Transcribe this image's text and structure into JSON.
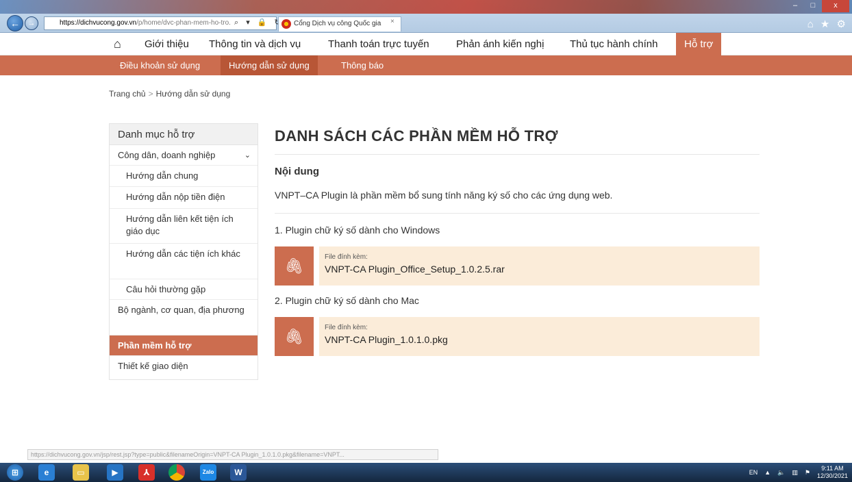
{
  "browser": {
    "url_host": "https://dichvucong.gov.vn",
    "url_path": "/p/home/dvc-phan-mem-ho-tro.",
    "tab_title": "Cổng Dịch vụ công Quốc gia",
    "tab_close": "×",
    "back": "←",
    "forward": "→",
    "address_icons": "⌕ ▾ 🔒 ↻"
  },
  "topnav": {
    "items": [
      "Giới thiệu",
      "Thông tin và dịch vụ",
      "Thanh toán trực tuyến",
      "Phản ánh kiến nghị",
      "Thủ tục hành chính",
      "Hỗ trợ"
    ],
    "active": "Hỗ trợ"
  },
  "subnav": {
    "items": [
      "Điều khoản sử dụng",
      "Hướng dẫn sử dụng",
      "Thông báo"
    ],
    "active": "Hướng dẫn sử dụng"
  },
  "breadcrumb": {
    "home": "Trang chủ",
    "sep": ">",
    "current": "Hướng dẫn sử dụng"
  },
  "sidebar": {
    "heading": "Danh mục hỗ trợ",
    "items": [
      {
        "label": "Công dân, doanh nghiệp"
      },
      {
        "label": "Hướng dẫn chung"
      },
      {
        "label": "Hướng dẫn nộp tiền điện"
      },
      {
        "label": "Hướng dẫn liên kết tiện ích giáo dục"
      },
      {
        "label": "Hướng dẫn các tiện ích khác"
      },
      {
        "label": "Câu hỏi thường gặp"
      },
      {
        "label": "Bộ ngành, cơ quan, địa phương"
      },
      {
        "label": "Phần mềm hỗ trợ"
      },
      {
        "label": "Thiết kế giao diện"
      }
    ]
  },
  "content": {
    "title": "DANH SÁCH CÁC PHẦN MỀM HỖ TRỢ",
    "section_heading": "Nội dung",
    "intro": "VNPT–CA Plugin là phần mềm bổ sung tính năng ký số cho các ứng dụng web.",
    "plugins": [
      {
        "title": "1. Plugin chữ ký số dành cho Windows",
        "attachment_label": "File đính kèm:",
        "file": "VNPT-CA Plugin_Office_Setup_1.0.2.5.rar"
      },
      {
        "title": "2. Plugin chữ ký số dành cho Mac",
        "attachment_label": "File đính kèm:",
        "file": "VNPT-CA Plugin_1.0.1.0.pkg"
      }
    ]
  },
  "statusbar": {
    "text": "https://dichvucong.gov.vn/jsp/rest.jsp?type=public&filenameOrigin=VNPT-CA Plugin_1.0.1.0.pkg&filename=VNPT..."
  },
  "taskbar": {
    "apps": [
      "start",
      "internet-explorer",
      "file-explorer",
      "media-player",
      "acrobat",
      "chrome",
      "zalo",
      "word"
    ],
    "word_label": "W",
    "zalo_label": "Zalo",
    "language": "EN",
    "time": "9:11 AM",
    "date": "12/30/2021"
  }
}
